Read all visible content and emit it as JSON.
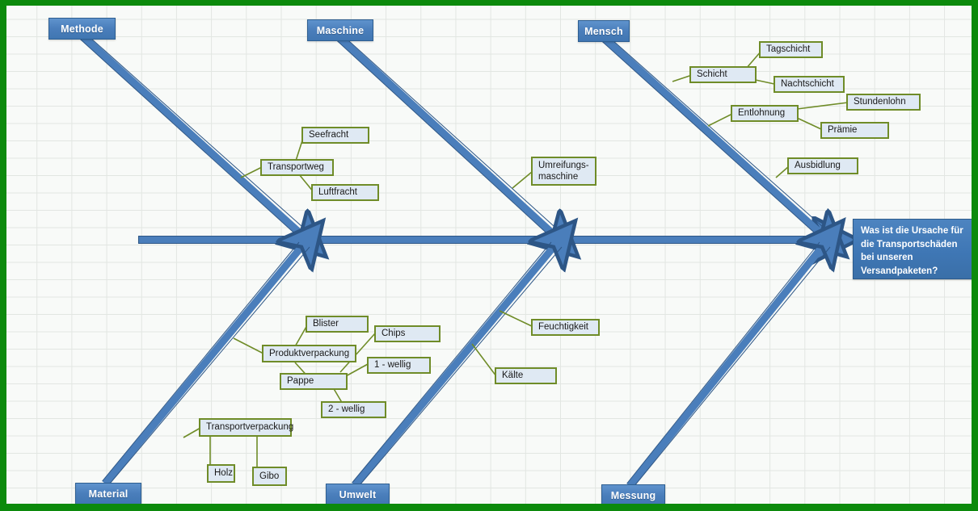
{
  "diagram": {
    "type": "ishikawa-fishbone",
    "problem": {
      "text": "Was ist  die Ursache für die Transportschäden bei unseren Versandpaketen?"
    },
    "colors": {
      "frame": "#0c8a0c",
      "bone": "#4a7ebb",
      "bone_outline": "#2d5686",
      "cause_fill": "#dfe9f3",
      "cause_border": "#6f8c28",
      "category_fill": "#4a7ebb",
      "grid": "#e2e6e2",
      "sheet": "#f8faf8"
    },
    "categories": [
      {
        "id": "methode",
        "label": "Methode"
      },
      {
        "id": "maschine",
        "label": "Maschine"
      },
      {
        "id": "mensch",
        "label": "Mensch"
      },
      {
        "id": "material",
        "label": "Material"
      },
      {
        "id": "umwelt",
        "label": "Umwelt"
      },
      {
        "id": "messung",
        "label": "Messung"
      }
    ],
    "causes": {
      "transportweg": "Transportweg",
      "seefracht": "Seefracht",
      "luftfracht": "Luftfracht",
      "umreifungsmaschine": "Umreifungs-\nmaschine",
      "schicht": "Schicht",
      "tagschicht": "Tagschicht",
      "nachtschicht": "Nachtschicht",
      "entlohnung": "Entlohnung",
      "stundenlohn": "Stundenlohn",
      "praemie": "Prämie",
      "ausbidlung": "Ausbidlung",
      "produktverpackung": "Produktverpackung",
      "blister": "Blister",
      "chips": "Chips",
      "pappe": "Pappe",
      "wellig1": "1 - wellig",
      "wellig2": "2 - wellig",
      "transportverpackung": "Transportverpackung",
      "holz": "Holz",
      "gibo": "Gibo",
      "feuchtigkeit": "Feuchtigkeit",
      "kaelte": "Kälte"
    }
  }
}
